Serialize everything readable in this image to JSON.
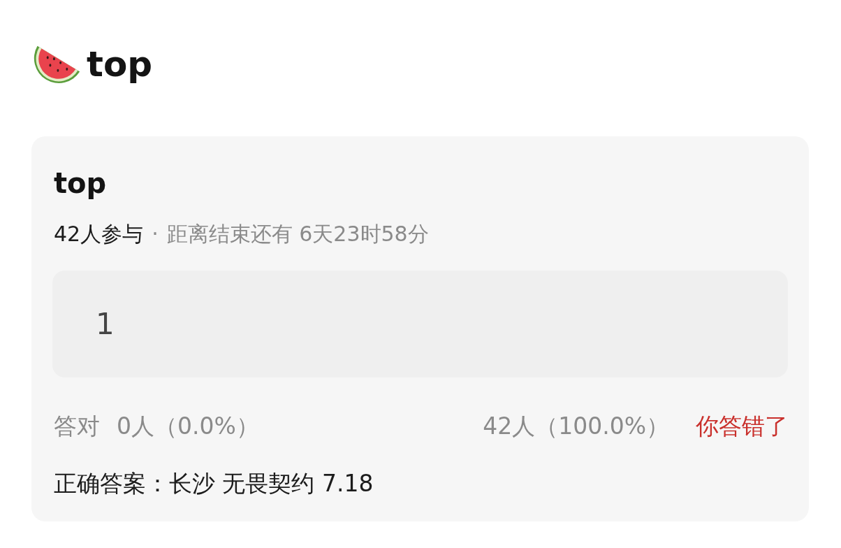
{
  "header": {
    "title": "top"
  },
  "quiz": {
    "title": "top",
    "participants": "42人参与",
    "separator": "·",
    "countdown": "距离结束还有 6天23时58分",
    "answer": {
      "value": "1"
    },
    "correct_stats": {
      "label": "答对",
      "value": "0人（0.0%）"
    },
    "wrong_stats": {
      "value": "42人（100.0%）"
    },
    "result": {
      "text": "你答错了",
      "correct": false
    },
    "correct_answer": {
      "text": "正确答案：长沙 无畏契约 7.18"
    }
  }
}
